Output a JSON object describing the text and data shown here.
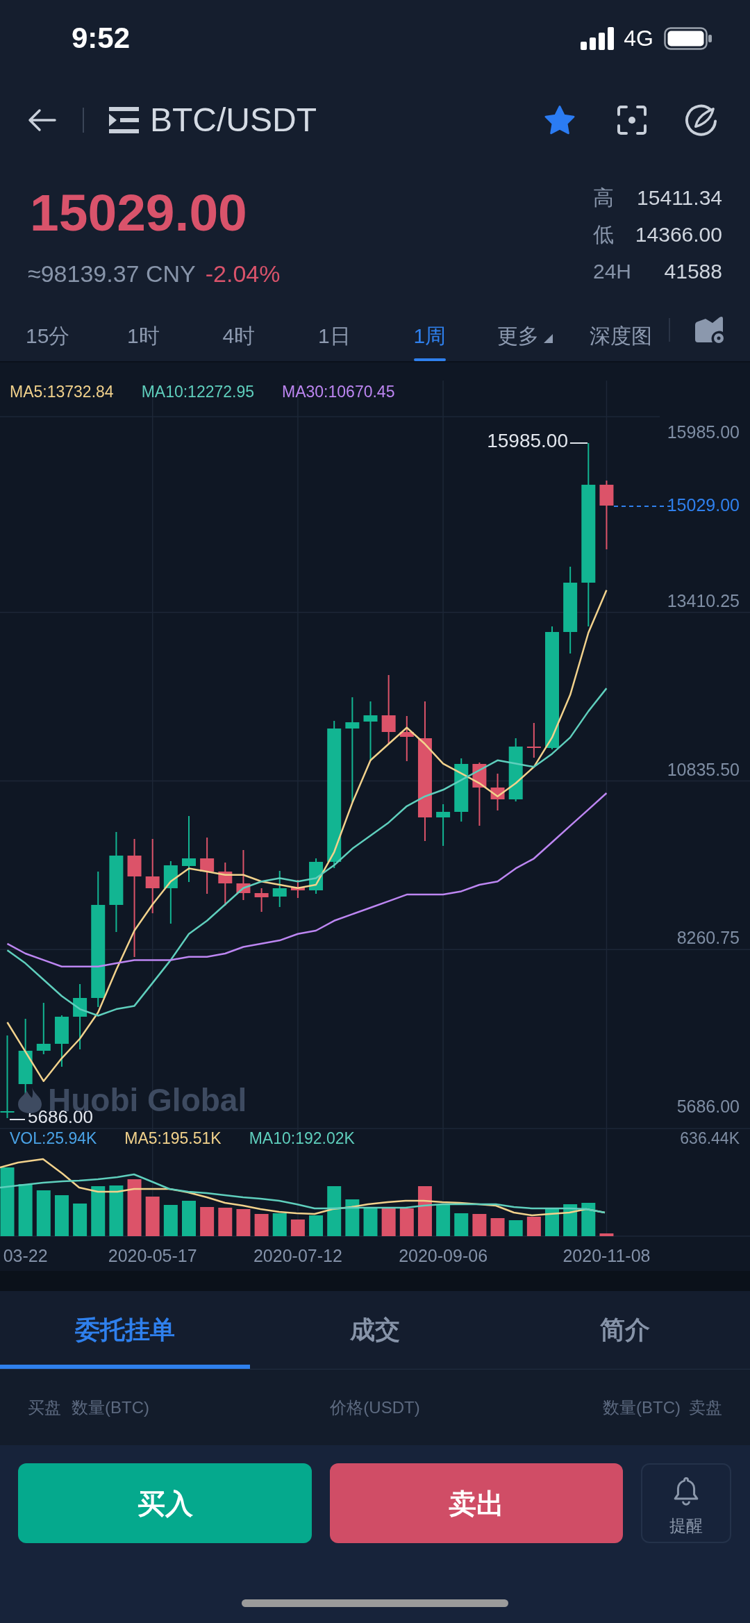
{
  "status_bar": {
    "time": "9:52",
    "network": "4G"
  },
  "header": {
    "pair": "BTC/USDT",
    "favorite": true
  },
  "ticker": {
    "price": "15029.00",
    "cny": "≈98139.37 CNY",
    "change": "-2.04%",
    "stats": [
      {
        "label": "高",
        "value": "15411.34"
      },
      {
        "label": "低",
        "value": "14366.00"
      },
      {
        "label": "24H",
        "value": "41588"
      }
    ]
  },
  "period_tabs": [
    {
      "label": "15分",
      "kind": "tab",
      "selected": false
    },
    {
      "label": "1时",
      "kind": "tab",
      "selected": false
    },
    {
      "label": "4时",
      "kind": "tab",
      "selected": false
    },
    {
      "label": "1日",
      "kind": "tab",
      "selected": false
    },
    {
      "label": "1周",
      "kind": "tab",
      "selected": true
    },
    {
      "label": "更多",
      "kind": "dropdown",
      "selected": false
    },
    {
      "label": "深度图",
      "kind": "tab",
      "selected": false
    }
  ],
  "chart": {
    "chart_data": {
      "type": "line",
      "grid": true,
      "categories": [
        null,
        "03-22",
        null,
        null,
        null,
        null,
        null,
        null,
        "2020-05-17",
        null,
        null,
        null,
        null,
        null,
        null,
        null,
        "2020-07-12",
        null,
        null,
        null,
        null,
        null,
        null,
        null,
        "2020-09-06",
        null,
        null,
        null,
        null,
        null,
        null,
        null,
        null,
        "2020-11-08"
      ],
      "ylim": [
        5686,
        15985
      ],
      "yticks": [
        {
          "value": 5686,
          "label": "5686.00"
        },
        {
          "value": 8260.75,
          "label": "8260.75"
        },
        {
          "value": 10835.5,
          "label": "10835.50"
        },
        {
          "value": 13410.25,
          "label": "13410.25"
        },
        {
          "value": 15985,
          "label": "15985.00"
        }
      ],
      "series": [
        {
          "name": "MA5:13732.84",
          "color": "#f2d28c",
          "values": [
            7150,
            6700,
            6250,
            6600,
            6900,
            7300,
            7950,
            8550,
            8950,
            9300,
            9500,
            9450,
            9400,
            9400,
            9300,
            9250,
            9200,
            9250,
            9750,
            10500,
            11150,
            11400,
            11650,
            11400,
            11100,
            10950,
            10800,
            10600,
            10800,
            11050,
            11500,
            12150,
            13100,
            13750
          ]
        },
        {
          "name": "MA10:12272.95",
          "color": "#5fcfbd",
          "values": [
            8250,
            8050,
            7800,
            7550,
            7350,
            7250,
            7350,
            7400,
            7750,
            8100,
            8500,
            8700,
            8950,
            9200,
            9300,
            9350,
            9300,
            9350,
            9550,
            9800,
            10000,
            10200,
            10450,
            10600,
            10700,
            10850,
            11000,
            11150,
            11100,
            11050,
            11250,
            11500,
            11900,
            12250
          ]
        },
        {
          "name": "MA30:10670.45",
          "color": "#bd86f2",
          "values": [
            8350,
            8200,
            8100,
            8000,
            8000,
            8000,
            8050,
            8100,
            8100,
            8100,
            8150,
            8150,
            8200,
            8300,
            8350,
            8400,
            8500,
            8550,
            8700,
            8800,
            8900,
            9000,
            9100,
            9100,
            9100,
            9150,
            9250,
            9300,
            9500,
            9650,
            9900,
            10150,
            10400,
            10650
          ]
        }
      ]
    },
    "current_price": "15029.00",
    "high_marker": "15985.00",
    "low_marker": "5686.00",
    "watermark": "Huobi Global",
    "volume_legend": [
      {
        "label": "VOL:25.94K",
        "color": "#4aa3e6"
      },
      {
        "label": "MA5:195.51K",
        "color": "#f2d28c"
      },
      {
        "label": "MA10:192.02K",
        "color": "#5fcfbd"
      }
    ],
    "volume_max": "636.44K"
  },
  "bottom_tabs": [
    {
      "label": "委托挂单",
      "selected": true
    },
    {
      "label": "成交",
      "selected": false
    },
    {
      "label": "简介",
      "selected": false
    }
  ],
  "order_book": {
    "columns": [
      "买盘",
      "数量(BTC)",
      "价格(USDT)",
      "数量(BTC)",
      "卖盘"
    ]
  },
  "actions": [
    {
      "kind": "buy",
      "label": "买入"
    },
    {
      "kind": "sell",
      "label": "卖出"
    },
    {
      "kind": "alert",
      "label": "提醒"
    }
  ]
}
